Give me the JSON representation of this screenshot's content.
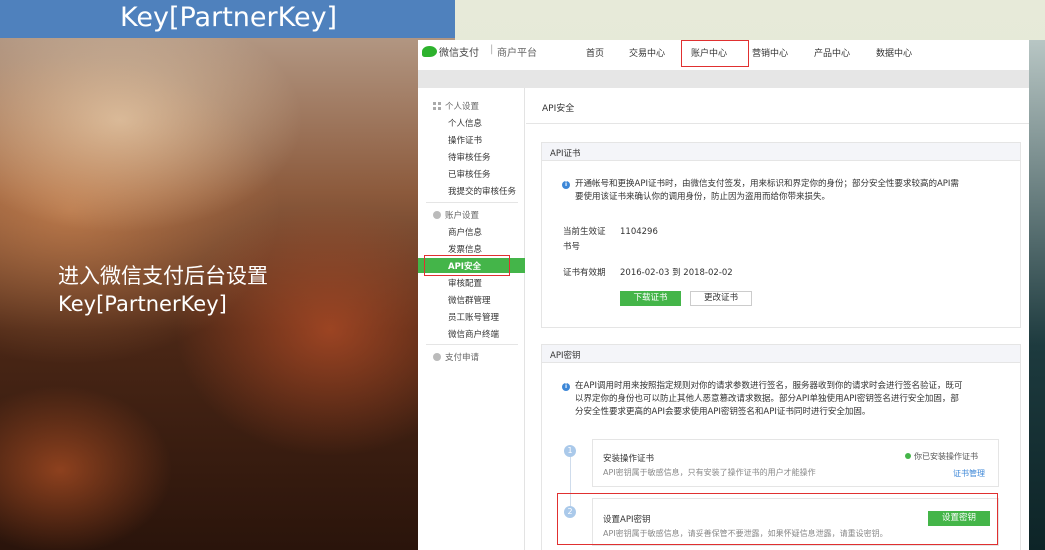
{
  "slide": {
    "title": "Key[PartnerKey]",
    "caption_line1": "进入微信支付后台设置",
    "caption_line2": "Key[PartnerKey]"
  },
  "brand": {
    "name": "微信支付",
    "separator": "|",
    "sub": "商户平台",
    "accent": "#44b549",
    "highlight": "#e03030"
  },
  "topnav": {
    "items": [
      "首页",
      "交易中心",
      "账户中心",
      "营销中心",
      "产品中心",
      "数据中心"
    ],
    "active": "账户中心"
  },
  "sidebar": {
    "groups": [
      {
        "label": "个人设置",
        "icon": "grid-icon",
        "items": [
          "个人信息",
          "操作证书",
          "待审核任务",
          "已审核任务",
          "我提交的审核任务"
        ]
      },
      {
        "label": "账户设置",
        "icon": "gear-icon",
        "items": [
          "商户信息",
          "发票信息",
          "API安全",
          "审核配置",
          "微信群管理",
          "员工账号管理",
          "微信商户终端"
        ]
      },
      {
        "label": "支付申请",
        "icon": "check-icon",
        "items": []
      }
    ],
    "active": "API安全"
  },
  "main": {
    "page_title": "API安全",
    "cert_card": {
      "title": "API证书",
      "notice": "开通帐号和更换API证书时，由微信支付签发，用来标识和界定你的身份；部分安全性要求较高的API需要使用该证书来确认你的调用身份，防止因为盗用而给你带来损失。",
      "notice_line1": "开通帐号和更换API证书时，由微信支付签发，用来标识和界定你的身份；部分安全性要求较高的API需",
      "notice_line2": "要使用该证书来确认你的调用身份，防止因为盗用而给你带来损失。",
      "serial_label_line1": "当前生效证",
      "serial_label_line2": "书号",
      "serial_value": "1104296",
      "validity_label": "证书有效期",
      "validity_value": "2016-02-03  到  2018-02-02",
      "download_button": "下载证书",
      "change_button": "更改证书"
    },
    "key_card": {
      "title": "API密钥",
      "notice_line1": "在API调用时用来按照指定规则对你的请求参数进行签名，服务器收到你的请求时会进行签名验证，既可",
      "notice_line2": "以界定你的身份也可以防止其他人恶意篡改请求数据。部分API单独使用API密钥签名进行安全加固，部",
      "notice_line3": "分安全性要求更高的API会要求使用API密钥签名和API证书同时进行安全加固。",
      "steps": [
        {
          "number": "1",
          "title": "安装操作证书",
          "desc": "API密钥属于敏感信息，只有安装了操作证书的用户才能操作",
          "status": "你已安装操作证书",
          "link": "证书管理"
        },
        {
          "number": "2",
          "title": "设置API密钥",
          "desc": "API密钥属于敏感信息，请妥善保管不要泄露，如果怀疑信息泄露，请重设密钥。",
          "button": "设置密钥"
        }
      ]
    }
  }
}
